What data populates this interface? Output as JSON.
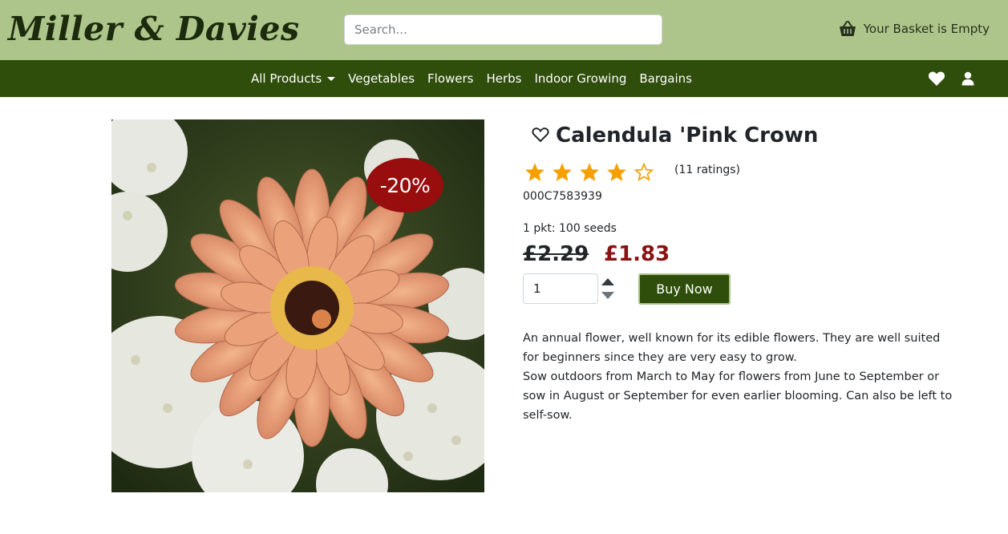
{
  "header": {
    "logo": "Miller & Davies",
    "search_placeholder": "Search...",
    "basket_text": "Your Basket is Empty"
  },
  "nav": {
    "links": [
      "All Products",
      "Vegetables",
      "Flowers",
      "Herbs",
      "Indoor Growing",
      "Bargains"
    ]
  },
  "product": {
    "title": "Calendula 'Pink Crown",
    "rating_stars": 4,
    "max_stars": 5,
    "ratings_text": "(11 ratings)",
    "sku": "000C7583939",
    "pack": "1 pkt: 100 seeds",
    "old_price": "£2.29",
    "new_price": "£1.83",
    "discount": "-20%",
    "quantity": "1",
    "buy_label": "Buy Now",
    "description": [
      "An annual flower, well known for its edible flowers. They are well suited for beginners since they are very easy to grow.",
      "Sow outdoors from March to May for flowers from June to September or sow in August or September for even earlier blooming. Can also be left to self-sow."
    ]
  },
  "colors": {
    "header_bg": "#adc48a",
    "nav_bg": "#2f4d0b",
    "star": "#f5a000",
    "sale_price": "#8b1212",
    "badge_bg": "#980e0e"
  }
}
